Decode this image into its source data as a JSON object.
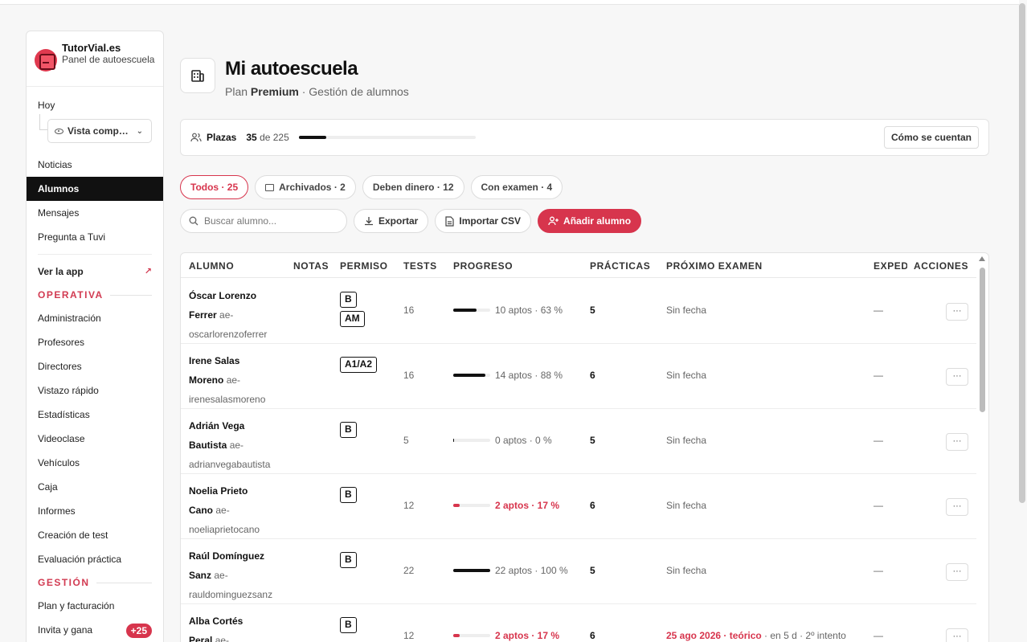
{
  "brand": {
    "name": "TutorVial.es",
    "subtitle": "Panel de autoescuela"
  },
  "sidebar": {
    "hoy": "Hoy",
    "vista": "Vista comp…",
    "items": [
      "Noticias",
      "Alumnos",
      "Mensajes",
      "Pregunta a Tuvi"
    ],
    "ver_app": "Ver la app",
    "operativa_title": "OPERATIVA",
    "operativa": [
      "Administración",
      "Profesores",
      "Directores",
      "Vistazo rápido",
      "Estadísticas",
      "Videoclase",
      "Vehículos",
      "Caja",
      "Informes",
      "Creación de test",
      "Evaluación práctica"
    ],
    "gestion_title": "GESTIÓN",
    "gestion": [
      "Plan y facturación",
      "Invita y gana"
    ],
    "invite_badge": "+25"
  },
  "header": {
    "title": "Mi autoescuela",
    "plan_prefix": "Plan",
    "plan_name": "Premium",
    "plan_suffix": "· Gestión de alumnos"
  },
  "plazas": {
    "label": "Plazas",
    "used": "35",
    "of_text": "de 225",
    "fraction": 0.156,
    "how_button": "Cómo se cuentan"
  },
  "filters": [
    "Todos · 25",
    "Archivados · 2",
    "Deben dinero · 12",
    "Con examen · 4"
  ],
  "toolbar": {
    "search_placeholder": "Buscar alumno...",
    "export": "Exportar",
    "import": "Importar CSV",
    "add": "Añadir alumno"
  },
  "table": {
    "headers": [
      "ALUMNO",
      "NOTAS",
      "PERMISO",
      "TESTS",
      "PROGRESO",
      "PRÁCTICAS",
      "PRÓXIMO EXAMEN",
      "EXPED",
      "ACCIONES"
    ],
    "rows": [
      {
        "first": "Óscar Lorenzo",
        "last": "Ferrer",
        "user1": "ae-",
        "user2": "oscarlorenzoferrer",
        "permisos": [
          "B",
          "AM"
        ],
        "tests": "16",
        "progress": 0.63,
        "progress_text": "10 aptos · 63 %",
        "low": false,
        "practicas": "5",
        "exam": "Sin fecha",
        "exam_detail": "",
        "exped": "—",
        "actions": "···"
      },
      {
        "first": "Irene Salas",
        "last": "Moreno",
        "user1": "ae-",
        "user2": "irenesalasmoreno",
        "permisos": [
          "A1/A2"
        ],
        "tests": "16",
        "progress": 0.88,
        "progress_text": "14 aptos · 88 %",
        "low": false,
        "practicas": "6",
        "exam": "Sin fecha",
        "exam_detail": "",
        "exped": "—",
        "actions": "···"
      },
      {
        "first": "Adrián Vega",
        "last": "Bautista",
        "user1": "ae-",
        "user2": "adrianvegabautista",
        "permisos": [
          "B"
        ],
        "tests": "5",
        "progress": 0.0,
        "progress_text": "0 aptos · 0 %",
        "low": false,
        "practicas": "5",
        "exam": "Sin fecha",
        "exam_detail": "",
        "exped": "—",
        "actions": "···"
      },
      {
        "first": "Noelia Prieto",
        "last": "Cano",
        "user1": "ae-",
        "user2": "noeliaprietocano",
        "permisos": [
          "B"
        ],
        "tests": "12",
        "progress": 0.17,
        "progress_text": "2 aptos · 17 %",
        "low": true,
        "practicas": "6",
        "exam": "Sin fecha",
        "exam_detail": "",
        "exped": "—",
        "actions": "···"
      },
      {
        "first": "Raúl Domínguez",
        "last": "Sanz",
        "user1": "ae-",
        "user2": "rauldominguezsanz",
        "permisos": [
          "B"
        ],
        "tests": "22",
        "progress": 1.0,
        "progress_text": "22 aptos · 100 %",
        "low": false,
        "practicas": "5",
        "exam": "Sin fecha",
        "exam_detail": "",
        "exped": "—",
        "actions": "···"
      },
      {
        "first": "Alba Cortés",
        "last": "Peral",
        "user1": "ae-",
        "user2": "",
        "permisos": [
          "B"
        ],
        "tests": "12",
        "progress": 0.17,
        "progress_text": "2 aptos · 17 %",
        "low": true,
        "practicas": "6",
        "exam": "25 ago 2026 · teórico",
        "exam_detail": " · en 5 d · 2º intento",
        "exped": "—",
        "actions": "···"
      }
    ]
  },
  "colors": {
    "accent": "#d7354d",
    "active_nav": "#111111"
  }
}
